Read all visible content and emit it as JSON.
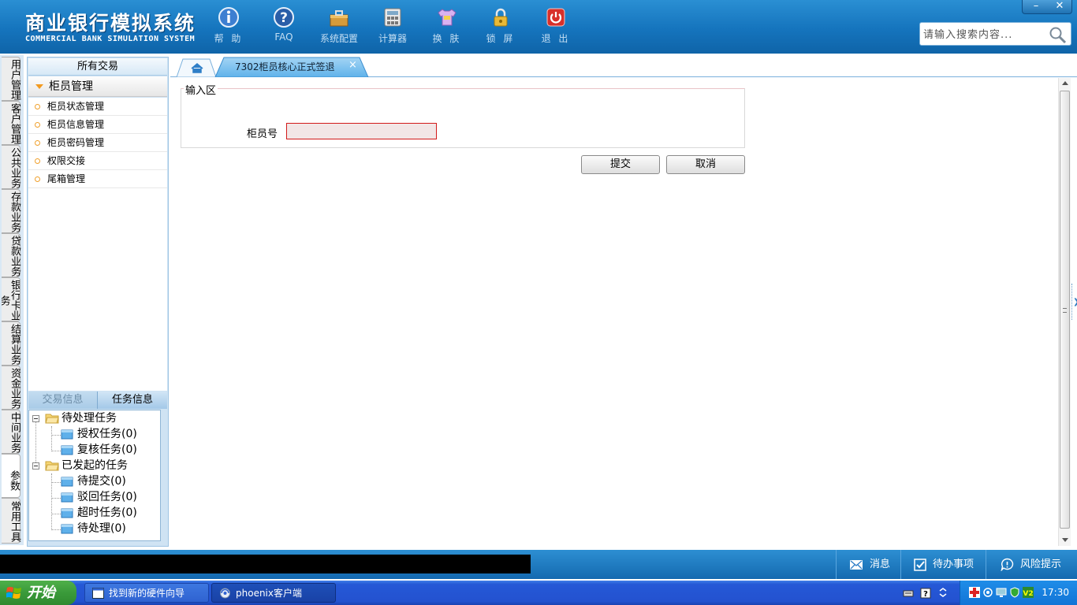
{
  "header": {
    "title_cn": "商业银行模拟系统",
    "title_en": "COMMERCIAL BANK SIMULATION SYSTEM",
    "buttons": [
      {
        "label": "帮 助",
        "icon": "info-icon"
      },
      {
        "label": "FAQ",
        "icon": "question-icon"
      },
      {
        "label": "系统配置",
        "icon": "toolbox-icon"
      },
      {
        "label": "计算器",
        "icon": "calculator-icon"
      },
      {
        "label": "换 肤",
        "icon": "shirt-icon"
      },
      {
        "label": "锁 屏",
        "icon": "lock-icon"
      },
      {
        "label": "退 出",
        "icon": "power-icon"
      }
    ],
    "window_controls": {
      "minimize": "–",
      "close": "✕"
    },
    "search_placeholder": "请输入搜索内容..."
  },
  "vertical_tabs": [
    "用户管理",
    "客户管理",
    "公共业务",
    "存款业务",
    "贷款业务",
    "银行卡业务",
    "结算业务",
    "资金业务",
    "中间业务",
    "参数",
    "常用工具"
  ],
  "left_menu": {
    "top_title": "所有交易",
    "group_title": "柜员管理",
    "items": [
      "柜员状态管理",
      "柜员信息管理",
      "柜员密码管理",
      "权限交接",
      "尾箱管理"
    ]
  },
  "info_tabs": {
    "trade": "交易信息",
    "task": "任务信息"
  },
  "task_tree": {
    "pending": {
      "label": "待处理任务",
      "children": [
        "授权任务(0)",
        "复核任务(0)"
      ]
    },
    "initiated": {
      "label": "已发起的任务",
      "children": [
        "待提交(0)",
        "驳回任务(0)",
        "超时任务(0)",
        "待处理(0)"
      ]
    }
  },
  "tabs": {
    "home_icon": "home-icon",
    "active_tab_label": "7302柜员核心正式签退",
    "close": "×"
  },
  "form": {
    "legend": "输入区",
    "teller_label": "柜员号",
    "teller_value": "",
    "submit": "提交",
    "cancel": "取消"
  },
  "status_bar": {
    "messages": "消息",
    "todo": "待办事项",
    "risk": "风险提示"
  },
  "taskbar": {
    "start": "开始",
    "tasks": [
      "找到新的硬件向导",
      "phoenix客户端"
    ],
    "clock": "17:30"
  },
  "colors": {
    "header_blue": "#1574bd",
    "accent_orange": "#f39a1f",
    "input_error_border": "#d21a1a"
  }
}
